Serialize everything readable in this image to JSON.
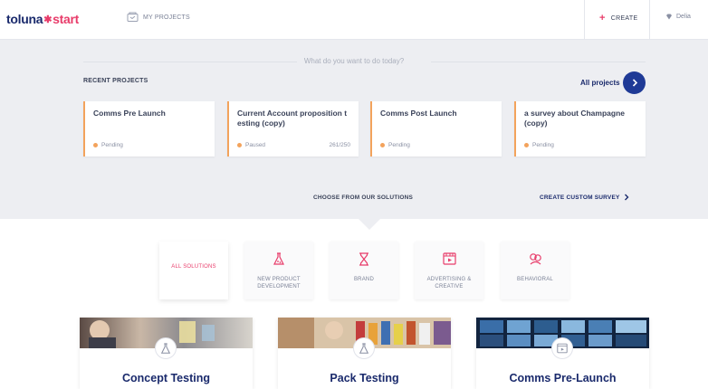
{
  "nav": {
    "brand_part1": "toluna",
    "brand_part2": "start",
    "my_projects": "MY PROJECTS",
    "create": "CREATE",
    "user": "Delia"
  },
  "prompt": "What do you want to do today?",
  "recent": {
    "title": "RECENT PROJECTS",
    "all_projects": "All projects",
    "cards": [
      {
        "title": "Comms Pre Launch",
        "status": "Pending",
        "count": ""
      },
      {
        "title": "Current Account proposition t esting (copy)",
        "status": "Paused",
        "count": "261/250"
      },
      {
        "title": "Comms Post Launch",
        "status": "Pending",
        "count": ""
      },
      {
        "title": "a survey about Champagne (copy)",
        "status": "Pending",
        "count": ""
      }
    ]
  },
  "solutions": {
    "choose": "CHOOSE FROM OUR SOLUTIONS",
    "custom_survey": "CREATE CUSTOM SURVEY",
    "tiles": [
      {
        "label": "ALL SOLUTIONS",
        "icon": "none"
      },
      {
        "label": "NEW PRODUCT DEVELOPMENT",
        "icon": "flask-icon"
      },
      {
        "label": "BRAND",
        "icon": "hourglass-icon"
      },
      {
        "label": "ADVERTISING & CREATIVE",
        "icon": "video-icon"
      },
      {
        "label": "BEHAVIORAL",
        "icon": "people-icon"
      }
    ],
    "cards": [
      {
        "name": "Concept Testing",
        "icon": "flask-icon"
      },
      {
        "name": "Pack Testing",
        "icon": "flask-icon"
      },
      {
        "name": "Comms Pre-Launch",
        "icon": "video-icon"
      }
    ]
  },
  "colors": {
    "brand_navy": "#1a2a6c",
    "brand_pink": "#e83c6a",
    "status_orange": "#f3a35c",
    "button_blue": "#1f3a96"
  }
}
